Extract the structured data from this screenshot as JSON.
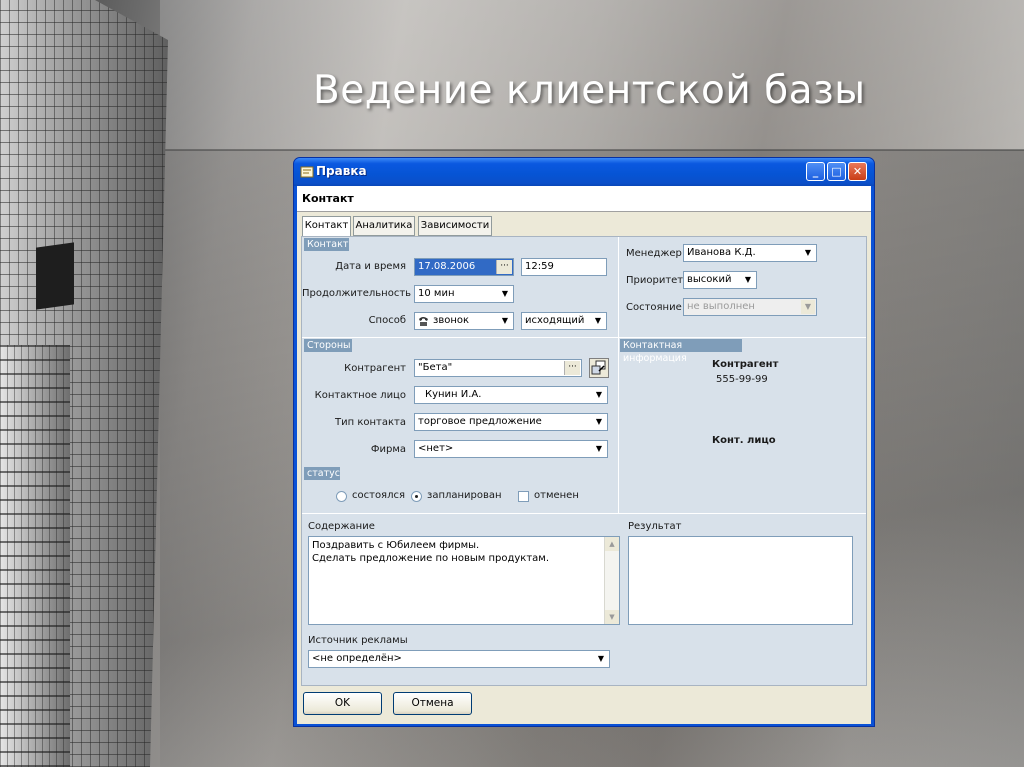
{
  "slide": {
    "title": "Ведение клиентской базы"
  },
  "window": {
    "title": "Правка",
    "header": "Контакт",
    "controls": {
      "minimize": "_",
      "maximize": "□",
      "close": "✕"
    }
  },
  "tabs": [
    {
      "label": "Контакт",
      "active": true
    },
    {
      "label": "Аналитика",
      "active": false
    },
    {
      "label": "Зависимости",
      "active": false
    }
  ],
  "contact_group": {
    "title": "Контакт",
    "datetime_label": "Дата и время",
    "date_value": "17.08.2006",
    "time_value": "12:59",
    "duration_label": "Продолжительность",
    "duration_value": "10 мин",
    "method_label": "Способ",
    "method_value": "звонок",
    "direction_value": "исходящий"
  },
  "manager_group": {
    "manager_label": "Менеджер",
    "manager_value": "Иванова К.Д.",
    "priority_label": "Приоритет",
    "priority_value": "высокий",
    "state_label": "Состояние",
    "state_value": "не выполнен"
  },
  "parties_group": {
    "title": "Стороны",
    "counterparty_label": "Контрагент",
    "counterparty_value": "\"Бета\"",
    "contact_person_label": "Контактное лицо",
    "contact_person_value": "Кунин И.А.",
    "contact_type_label": "Тип контакта",
    "contact_type_value": "торговое предложение",
    "firm_label": "Фирма",
    "firm_value": "<нет>"
  },
  "contact_info_group": {
    "title": "Контактная информация",
    "counterparty_heading": "Контрагент",
    "counterparty_phone": "555-99-99",
    "contact_person_heading": "Конт. лицо"
  },
  "status_group": {
    "title": "статус",
    "options": [
      {
        "label": "состоялся",
        "selected": false
      },
      {
        "label": "запланирован",
        "selected": true
      }
    ],
    "cancelled_label": "отменен",
    "cancelled_checked": false
  },
  "content": {
    "content_label": "Содержание",
    "content_line1": "Поздравить с Юбилеем фирмы.",
    "content_line2": "Сделать предложение по новым продуктам.",
    "result_label": "Результат",
    "ad_source_label": "Источник рекламы",
    "ad_source_value": "<не определён>"
  },
  "buttons": {
    "ok": "OK",
    "cancel": "Отмена"
  }
}
